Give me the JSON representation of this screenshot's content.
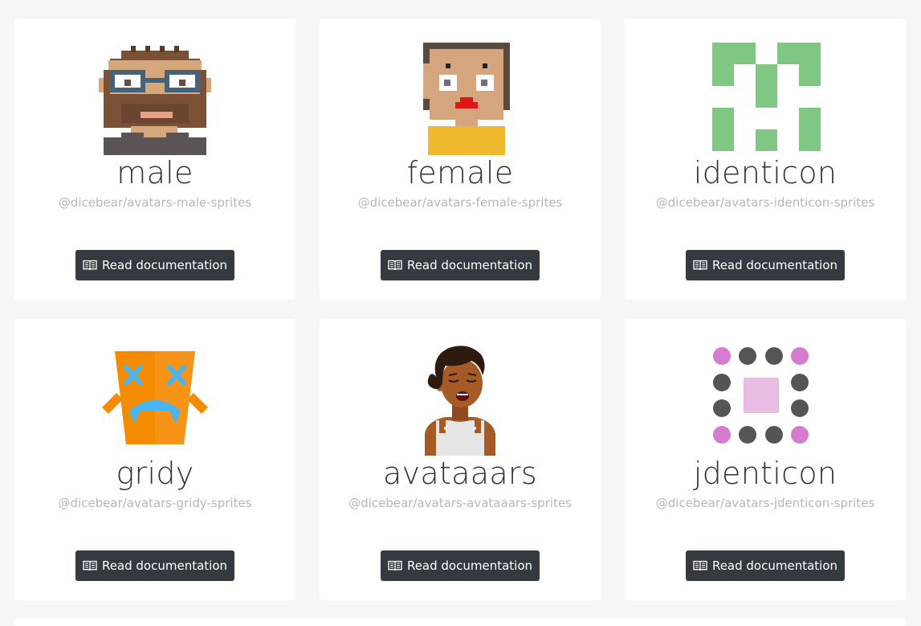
{
  "cards": [
    {
      "title": "male",
      "package": "@dicebear/avatars-male-sprites",
      "button_label": "Read documentation",
      "avatar_icon": "male-pixel-avatar"
    },
    {
      "title": "female",
      "package": "@dicebear/avatars-female-sprites",
      "button_label": "Read documentation",
      "avatar_icon": "female-pixel-avatar"
    },
    {
      "title": "identicon",
      "package": "@dicebear/avatars-identicon-sprites",
      "button_label": "Read documentation",
      "avatar_icon": "identicon-avatar"
    },
    {
      "title": "gridy",
      "package": "@dicebear/avatars-gridy-sprites",
      "button_label": "Read documentation",
      "avatar_icon": "gridy-avatar"
    },
    {
      "title": "avataaars",
      "package": "@dicebear/avatars-avataaars-sprites",
      "button_label": "Read documentation",
      "avatar_icon": "avataaars-avatar"
    },
    {
      "title": "jdenticon",
      "package": "@dicebear/avatars-jdenticon-sprites",
      "button_label": "Read documentation",
      "avatar_icon": "jdenticon-avatar"
    }
  ],
  "colors": {
    "page_bg": "#f5f6f8",
    "card_bg": "#ffffff",
    "button_bg": "#343a40",
    "title_text": "#2d333a",
    "package_text": "#b3b7bb",
    "identicon_green": "#80c783",
    "gridy_orange": "#f48b00",
    "gridy_blue": "#48b5f0",
    "jdenticon_pink": "#d57bd0",
    "jdenticon_gray": "#555555"
  }
}
